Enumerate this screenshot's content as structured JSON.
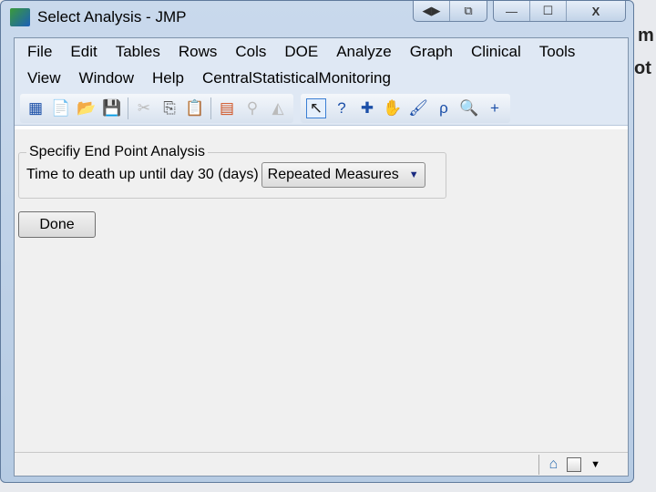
{
  "window": {
    "title": "Select Analysis - JMP",
    "buttons": [
      "◀▶",
      "⧉",
      "—",
      "☐",
      "X"
    ]
  },
  "background_text": [
    "m",
    "ot"
  ],
  "menu": {
    "row1": [
      "File",
      "Edit",
      "Tables",
      "Rows",
      "Cols",
      "DOE",
      "Analyze",
      "Graph",
      "Clinical",
      "Tools"
    ],
    "row2": [
      "View",
      "Window",
      "Help",
      "CentralStatisticalMonitoring"
    ]
  },
  "toolbar": {
    "group1": [
      "new-data-table-icon",
      "new-script-icon",
      "open-icon",
      "save-icon",
      "cut-icon",
      "copy-icon",
      "paste-icon",
      "data-grid-icon",
      "report-icon",
      "graph-icon"
    ],
    "group2": [
      "arrow-icon",
      "help-icon",
      "crosshair-icon",
      "hand-icon",
      "brush-icon",
      "lasso-icon",
      "magnifier-icon",
      "plus-icon"
    ]
  },
  "panel": {
    "legend": "Specifiy End Point Analysis",
    "label": "Time to death up until day 30 (days)",
    "combo_value": "Repeated Measures"
  },
  "done_label": "Done"
}
